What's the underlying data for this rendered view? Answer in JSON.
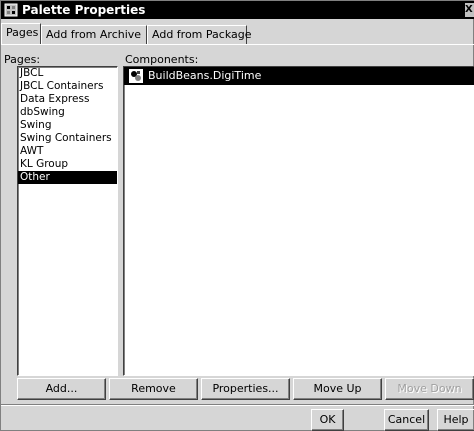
{
  "window": {
    "title": "Palette Properties",
    "close_glyph": "X"
  },
  "tabs": [
    {
      "label": "Pages",
      "active": true
    },
    {
      "label": "Add from Archive",
      "active": false
    },
    {
      "label": "Add from Package",
      "active": false
    }
  ],
  "pages": {
    "label": "Pages:",
    "items": [
      "JBCL",
      "JBCL Containers",
      "Data Express",
      "dbSwing",
      "Swing",
      "Swing Containers",
      "AWT",
      "KL Group",
      "Other"
    ],
    "selected": "Other"
  },
  "components": {
    "label": "Components:",
    "items": [
      "BuildBeans.DigiTime"
    ],
    "selected": "BuildBeans.DigiTime"
  },
  "actions": {
    "add": "Add...",
    "remove": "Remove",
    "properties": "Properties...",
    "move_up": "Move Up",
    "move_down": "Move Down"
  },
  "dialog_buttons": {
    "ok": "OK",
    "cancel": "Cancel",
    "help": "Help"
  }
}
